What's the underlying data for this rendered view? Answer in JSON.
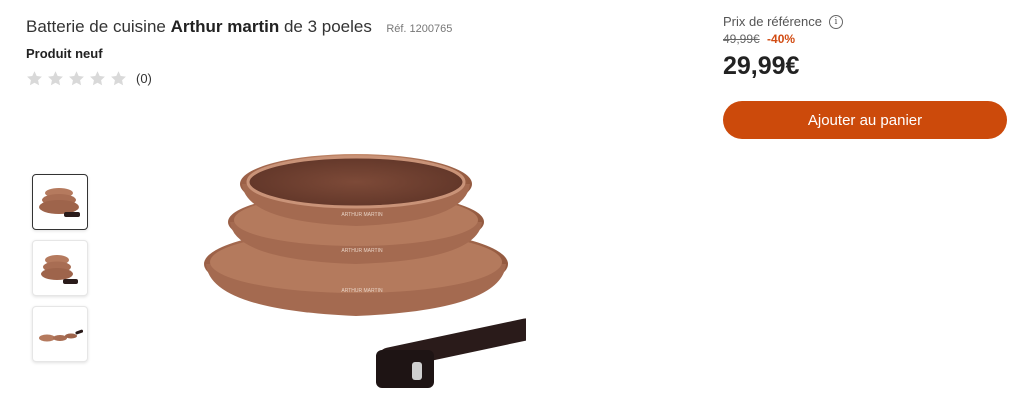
{
  "product": {
    "title_prefix": "Batterie de cuisine ",
    "title_brand": "Arthur martin",
    "title_suffix": " de 3 poeles",
    "reference": "Réf. 1200765",
    "condition": "Produit neuf",
    "rating_count": "(0)",
    "rating_value": 0,
    "rating_max": 5,
    "pan_brand_mark": "ARTHUR MARTIN"
  },
  "pricing": {
    "reference_label": "Prix de référence",
    "info_icon": "i",
    "old_price": "49,99€",
    "discount": "-40%",
    "price": "29,99€",
    "add_to_cart_label": "Ajouter au panier"
  },
  "gallery": {
    "thumbnail_count": 3,
    "active_index": 0
  },
  "colors": {
    "accent": "#cc4a0b",
    "discount": "#d14b12",
    "pan_copper": "#b57a5e",
    "handle": "#2a1b1a"
  }
}
